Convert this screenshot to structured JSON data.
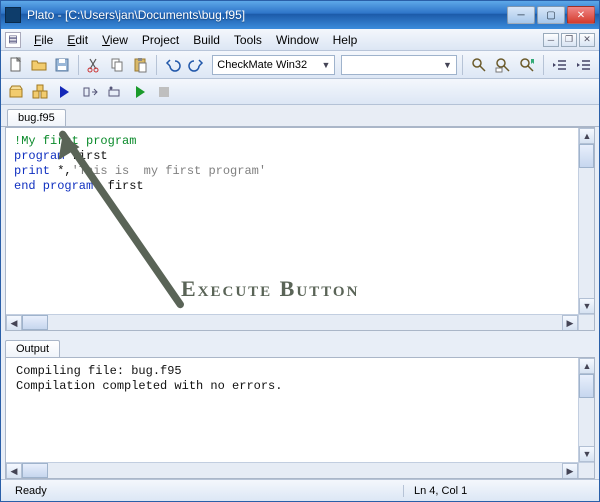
{
  "title": "Plato - [C:\\Users\\jan\\Documents\\bug.f95]",
  "menus": {
    "file": "File",
    "edit": "Edit",
    "view": "View",
    "project": "Project",
    "build": "Build",
    "tools": "Tools",
    "window": "Window",
    "help": "Help"
  },
  "toolbar": {
    "config_combo": "CheckMate Win32"
  },
  "tabs": {
    "editor_tab": "bug.f95",
    "output_tab": "Output"
  },
  "code": {
    "l1_comment": "!My first program",
    "l2_kw": "program ",
    "l2_name": "first",
    "l3_kw": "print ",
    "l3_star": "*,",
    "l3_str": "'This is  my first program'",
    "l4_kw1": "end program",
    "l4_name": "  first"
  },
  "output": {
    "line1": "Compiling file: bug.f95",
    "line2": "Compilation completed with no errors."
  },
  "status": {
    "ready": "Ready",
    "pos": "Ln 4, Col 1"
  },
  "annotation": "Execute Button"
}
